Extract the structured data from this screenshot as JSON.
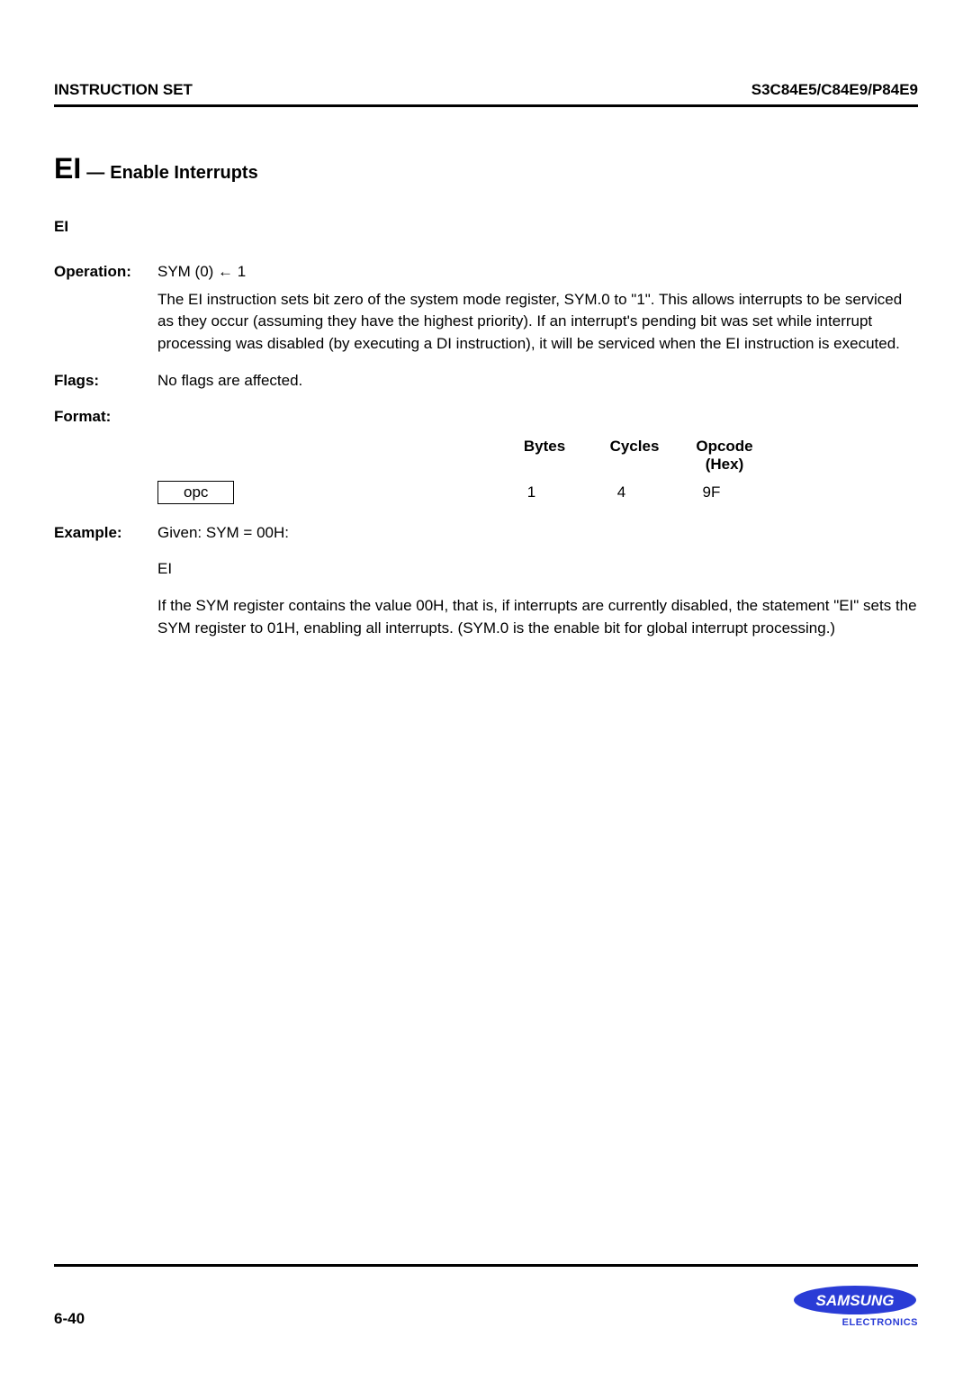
{
  "header": {
    "left": "INSTRUCTION SET",
    "right": "S3C84E5/C84E9/P84E9"
  },
  "title": {
    "mnemonic": "EI",
    "separator": " — ",
    "desc": "Enable Interrupts"
  },
  "mnemonic_line": "EI",
  "operation": {
    "label": "Operation:",
    "expr": "SYM (0)  ←  1",
    "desc": "The EI instruction sets bit zero of the system mode register, SYM.0 to \"1\". This allows interrupts to be serviced as they occur (assuming they have the highest priority). If an interrupt's pending bit was set while interrupt processing was disabled (by executing a DI instruction), it will be serviced when the EI instruction is executed."
  },
  "flags": {
    "label": "Flags:",
    "text": "No flags are affected."
  },
  "format": {
    "label": "Format:",
    "headers": {
      "bytes": "Bytes",
      "cycles": "Cycles",
      "opcode": "Opcode",
      "opcode_sub": "(Hex)"
    },
    "row": {
      "box": "opc",
      "bytes": "1",
      "cycles": "4",
      "opcode": "9F"
    }
  },
  "example": {
    "label": "Example:",
    "given": "Given:   SYM  =  00H:",
    "code": "EI",
    "desc": "If the SYM register contains the value 00H, that is, if interrupts are currently disabled, the statement \"EI\" sets the SYM register to 01H, enabling all interrupts. (SYM.0 is the enable bit for global interrupt processing.)"
  },
  "footer": {
    "page": "6-40",
    "logo_text": "SAMSUNG",
    "logo_sub": "ELECTRONICS"
  }
}
